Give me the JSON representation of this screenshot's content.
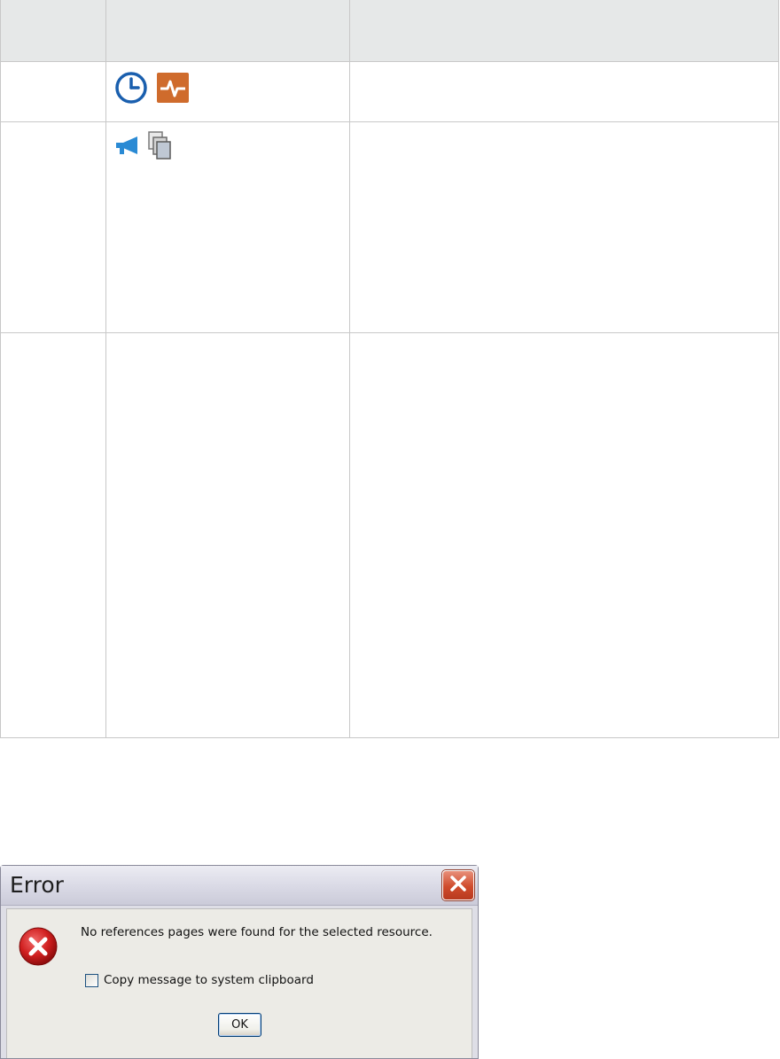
{
  "table": {
    "row1_icons": [
      "clock-icon",
      "pulse-icon"
    ],
    "row2_icons": [
      "megaphone-icon",
      "copy-icon"
    ]
  },
  "dialog": {
    "title": "Error",
    "message": "No references pages were found for the selected resource.",
    "checkbox_label": "Copy message to system clipboard",
    "checkbox_checked": false,
    "ok_label": "OK",
    "icons": {
      "close": "close-icon",
      "error": "error-icon"
    }
  },
  "colors": {
    "clock_blue": "#1a5fae",
    "pulse_orange": "#cf6b2c",
    "megaphone_blue": "#2a8ad4",
    "error_red": "#cc1a1a",
    "header_gray": "#e6e8e8"
  }
}
